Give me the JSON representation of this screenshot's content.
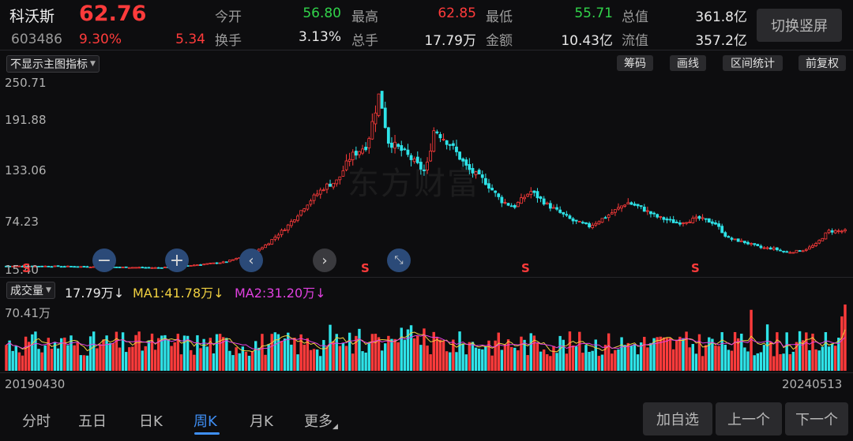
{
  "header": {
    "name": "科沃斯",
    "price": "62.76",
    "code": "603486",
    "pct_change": "9.30%",
    "change": "5.34",
    "stats": [
      {
        "label": "今开",
        "value": "56.80",
        "tone": "green"
      },
      {
        "label": "最高",
        "value": "62.85",
        "tone": "red"
      },
      {
        "label": "最低",
        "value": "55.71",
        "tone": "green"
      },
      {
        "label": "总值",
        "value": "361.8亿",
        "tone": "white"
      },
      {
        "label": "换手",
        "value": "3.13%",
        "tone": "white"
      },
      {
        "label": "总手",
        "value": "17.79万",
        "tone": "white"
      },
      {
        "label": "金额",
        "value": "10.43亿",
        "tone": "white"
      },
      {
        "label": "流值",
        "value": "357.2亿",
        "tone": "white"
      }
    ],
    "portrait_button": "切换竖屏"
  },
  "toolbar": {
    "indicator_select": "不显示主图指标",
    "buttons": [
      "筹码",
      "画线",
      "区间统计",
      "前复权"
    ]
  },
  "price_axis": {
    "ticks": [
      "250.71",
      "191.88",
      "133.06",
      "74.23",
      "15.40"
    ]
  },
  "sell_marker": "S",
  "watermark": "东方财富",
  "volume": {
    "selector": "成交量",
    "current": "17.79万",
    "ma1": "MA1:41.78万",
    "ma2": "MA2:31.20万",
    "arrow": "↓",
    "max_label": "70.41万"
  },
  "dates": {
    "start": "20190430",
    "end": "20240513"
  },
  "tabs": [
    "分时",
    "五日",
    "日K",
    "周K",
    "月K",
    "更多"
  ],
  "active_tab": "周K",
  "bottom_buttons": [
    "加自选",
    "上一个",
    "下一个"
  ],
  "colors": {
    "up": "#ff3b3b",
    "down": "#2ee3e8",
    "accent": "#3f8ff5",
    "ma1": "#f0d040",
    "ma2": "#e040e0"
  },
  "icons": [
    "zoom-out-icon",
    "zoom-in-icon",
    "scroll-left-icon",
    "scroll-right-icon",
    "collapse-icon"
  ],
  "chart_data": {
    "type": "candlestick",
    "period": "weekly",
    "x_range": [
      "20190430",
      "20240513"
    ],
    "y_ticks": [
      250.71,
      191.88,
      133.06,
      74.23,
      15.4
    ],
    "close_path": [
      [
        0,
        18
      ],
      [
        0.05,
        18
      ],
      [
        0.12,
        17
      ],
      [
        0.18,
        16
      ],
      [
        0.22,
        19
      ],
      [
        0.26,
        23
      ],
      [
        0.29,
        32
      ],
      [
        0.31,
        45
      ],
      [
        0.335,
        68
      ],
      [
        0.36,
        98
      ],
      [
        0.38,
        118
      ],
      [
        0.395,
        125
      ],
      [
        0.41,
        155
      ],
      [
        0.43,
        170
      ],
      [
        0.445,
        236
      ],
      [
        0.455,
        175
      ],
      [
        0.475,
        160
      ],
      [
        0.5,
        135
      ],
      [
        0.51,
        190
      ],
      [
        0.53,
        170
      ],
      [
        0.55,
        140
      ],
      [
        0.57,
        125
      ],
      [
        0.59,
        100
      ],
      [
        0.605,
        92
      ],
      [
        0.625,
        112
      ],
      [
        0.645,
        95
      ],
      [
        0.675,
        75
      ],
      [
        0.695,
        68
      ],
      [
        0.715,
        80
      ],
      [
        0.74,
        98
      ],
      [
        0.755,
        92
      ],
      [
        0.775,
        80
      ],
      [
        0.8,
        72
      ],
      [
        0.825,
        78
      ],
      [
        0.845,
        72
      ],
      [
        0.86,
        53
      ],
      [
        0.88,
        48
      ],
      [
        0.9,
        41
      ],
      [
        0.915,
        40
      ],
      [
        0.93,
        35
      ],
      [
        0.95,
        38
      ],
      [
        0.965,
        45
      ],
      [
        0.98,
        62
      ]
    ],
    "sell_marker_positions": [
      0.02,
      0.43,
      0.615,
      0.815
    ]
  }
}
